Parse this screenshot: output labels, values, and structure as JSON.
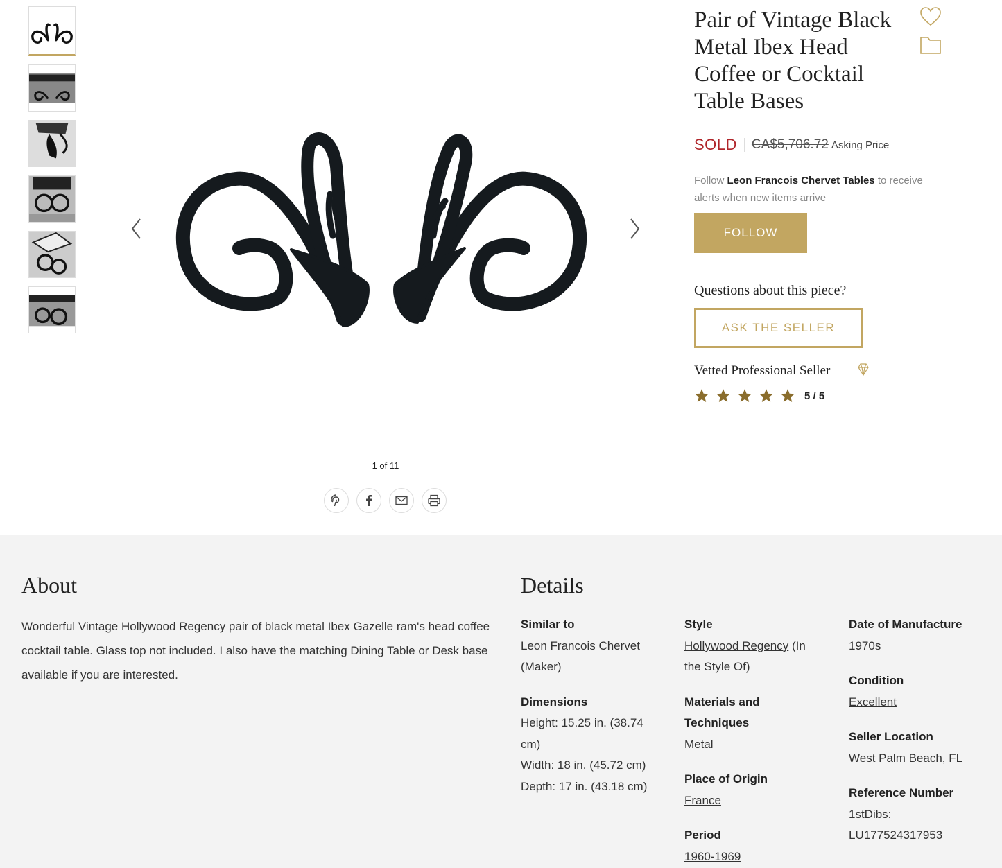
{
  "product": {
    "title": "Pair of Vintage Black Metal Ibex Head Coffee or Cocktail Table Bases",
    "sold": "SOLD",
    "price": "CA$5,706.72",
    "price_note": "Asking Price"
  },
  "gallery": {
    "counter": "1 of 11",
    "thumbnail_count": 6
  },
  "follow": {
    "prefix": "Follow",
    "seller_name": "Leon Francois Chervet Tables",
    "suffix": "to receive alerts when new items arrive",
    "button": "FOLLOW"
  },
  "questions": {
    "heading": "Questions about this piece?",
    "button": "ASK THE SELLER"
  },
  "seller": {
    "vetted": "Vetted Professional Seller",
    "rating_text": "5 / 5",
    "rating_value": 5,
    "rating_max": 5
  },
  "colors": {
    "gold": "#c2a661",
    "sold_red": "#b0252a",
    "star": "#8a6d2c"
  },
  "about": {
    "heading": "About",
    "text": "Wonderful Vintage Hollywood Regency pair of black metal Ibex Gazelle ram's head coffee cocktail table. Glass top not included. I also have the matching Dining Table or Desk base available if you are interested."
  },
  "details": {
    "heading": "Details",
    "similar_label": "Similar to",
    "similar_value": "Leon Francois Chervet (Maker)",
    "dimensions_label": "Dimensions",
    "height": "Height: 15.25 in. (38.74 cm)",
    "width": "Width: 18 in. (45.72 cm)",
    "depth": "Depth: 17 in. (43.18 cm)",
    "style_label": "Style",
    "style_link": "Hollywood Regency",
    "style_suffix": " (In the Style Of)",
    "materials_label": "Materials and Techniques",
    "materials_value": "Metal",
    "origin_label": "Place of Origin",
    "origin_value": "France",
    "period_label": "Period",
    "period_value": "1960-1969",
    "date_label": "Date of Manufacture",
    "date_value": "1970s",
    "condition_label": "Condition",
    "condition_value": "Excellent",
    "location_label": "Seller Location",
    "location_value": "West Palm Beach, FL",
    "reference_label": "Reference Number",
    "reference_value": "1stDibs: LU177524317953"
  },
  "icons": {
    "favorite": "heart-icon",
    "folder": "folder-icon",
    "prev": "chevron-left-icon",
    "next": "chevron-right-icon",
    "pinterest": "pinterest-icon",
    "facebook": "facebook-icon",
    "email": "email-icon",
    "print": "print-icon",
    "vetted": "diamond-icon",
    "star": "star-icon"
  }
}
